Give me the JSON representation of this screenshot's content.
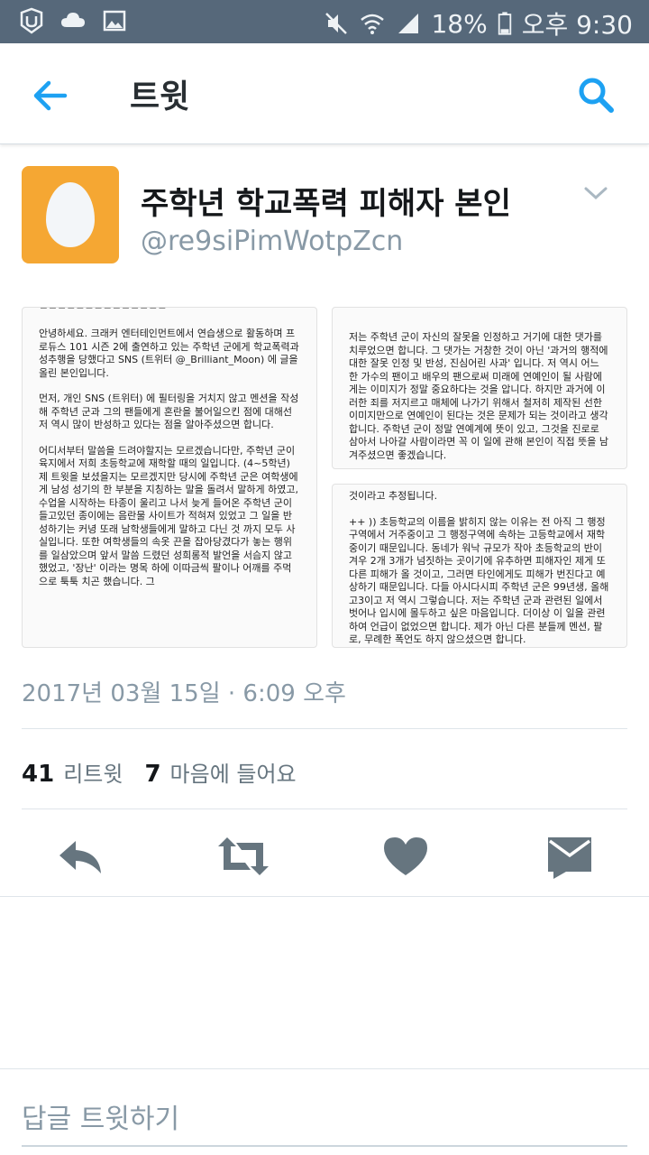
{
  "status_bar": {
    "battery": "18%",
    "time": "오후 9:30"
  },
  "app_bar": {
    "title": "트윗"
  },
  "author": {
    "display_name": "주학년 학교폭력 피해자 본인",
    "handle": "@re9siPimWotpZcn"
  },
  "media": {
    "doc1_paragraphs": [
      "안녕하세요. 크래커 엔터테인먼트에서 연습생으로 활동하며 프로듀스 101 시즌 2에 출연하고 있는 주학년 군에게 학교폭력과 성추행을 당했다고 SNS (트위터 @_Brilliant_Moon) 에 글을 올린 본인입니다.",
      "먼저, 개인 SNS (트위터) 에 필터링을 거치지 않고 멘션을 작성해 주학년 군과 그의 팬들에게 혼란을 불어일으킨 점에 대해선 저 역시 많이 반성하고 있다는 점을 알아주셨으면 합니다.",
      "어디서부터 말씀을 드려야할지는 모르겠습니다만, 주학년 군이 육지에서 저희 초등학교에 재학할 때의 일입니다. (4~5학년) 제 트윗을 보셨을지는 모르겠지만 당시에 주학년 군은 여학생에게 남성 성기의 한 부분을 지칭하는 말을 돌려서 말하게 하였고, 수업을 시작하는 타종이 울리고 나서 늦게 들어온 주학년 군이 들고있던 종이에는 음란물 사이트가 적혀져 있었고 그 일을 반성하기는 커녕 또래 남학생들에게 말하고 다닌 것 까지 모두 사실입니다. 또한 여학생들의 속옷 끈을 잡아당겼다가 놓는 행위를 일삼았으며 앞서 말씀 드렸던 성희롱적 발언을 서슴지 않고 했었고, '장난' 이라는 명목 하에 이따금씩 팔이나 어깨를 주먹으로 툭툭 치곤 했습니다. 그"
    ],
    "doc2_paragraphs": [
      "저는 주학년 군이 자신의 잘못을 인정하고 거기에 대한 댓가를 치루었으면 합니다. 그 댓가는 거창한 것이 아닌 '과거의 행적에 대한 잘못 인정 및 반성, 진심어린 사과' 입니다. 저 역시 어느 한 가수의 팬이고 배우의 팬으로써 미래에 연예인이 될 사람에게는 이미지가 정말 중요하다는 것을 압니다. 하지만 과거에 이러한 죄를 저지르고 매체에 나가기 위해서 철저히 제작된 선한 이미지만으로 연예인이 된다는 것은 문제가 되는 것이라고 생각합니다. 주학년 군이 정말 연예계에 뜻이 있고, 그것을 진로로 삼아서 나아갈 사람이라면 꼭 이 일에 관해 본인이 직접 뜻을 남겨주셨으면 좋겠습니다."
    ],
    "doc3_paragraphs": [
      "것이라고 추정됩니다.",
      "++ )) 초등학교의 이름을 밝히지 않는 이유는 전 아직 그 행정구역에서 거주중이고 그 행정구역에 속하는 고등학교에서 재학중이기 때문입니다. 동네가 워낙 규모가 작아 초등학교의 반이 겨우 2개 3개가 넘짓하는 곳이기에 유추하면 피해자인 제게 또 다른 피해가 올 것이고, 그러면 타인에게도 피해가 번진다고 예상하기 때문입니다. 다들 아시다시피 주학년 군은 99년생, 올해 고3이고 저 역시 그렇습니다. 저는 주학년 군과 관련된 일에서 벗어나 입시에 몰두하고 싶은 마음입니다. 더이상 이 일을 관련하여 언급이 없었으면 합니다. 제가 아닌 다른 분들께 멘션, 팔로, 무례한 폭언도 하지 않으셨으면 합니다."
    ]
  },
  "timestamp": "2017년 03월 15일 · 6:09 오후",
  "stats": {
    "retweets_count": "41",
    "retweets_label": "리트윗",
    "likes_count": "7",
    "likes_label": "마음에 들어요"
  },
  "reply": {
    "placeholder": "답글 트윗하기"
  },
  "colors": {
    "status_bar": "#56687a",
    "accent": "#1da1f2",
    "action_icon": "#66757f",
    "avatar_bg": "#f5a733"
  }
}
